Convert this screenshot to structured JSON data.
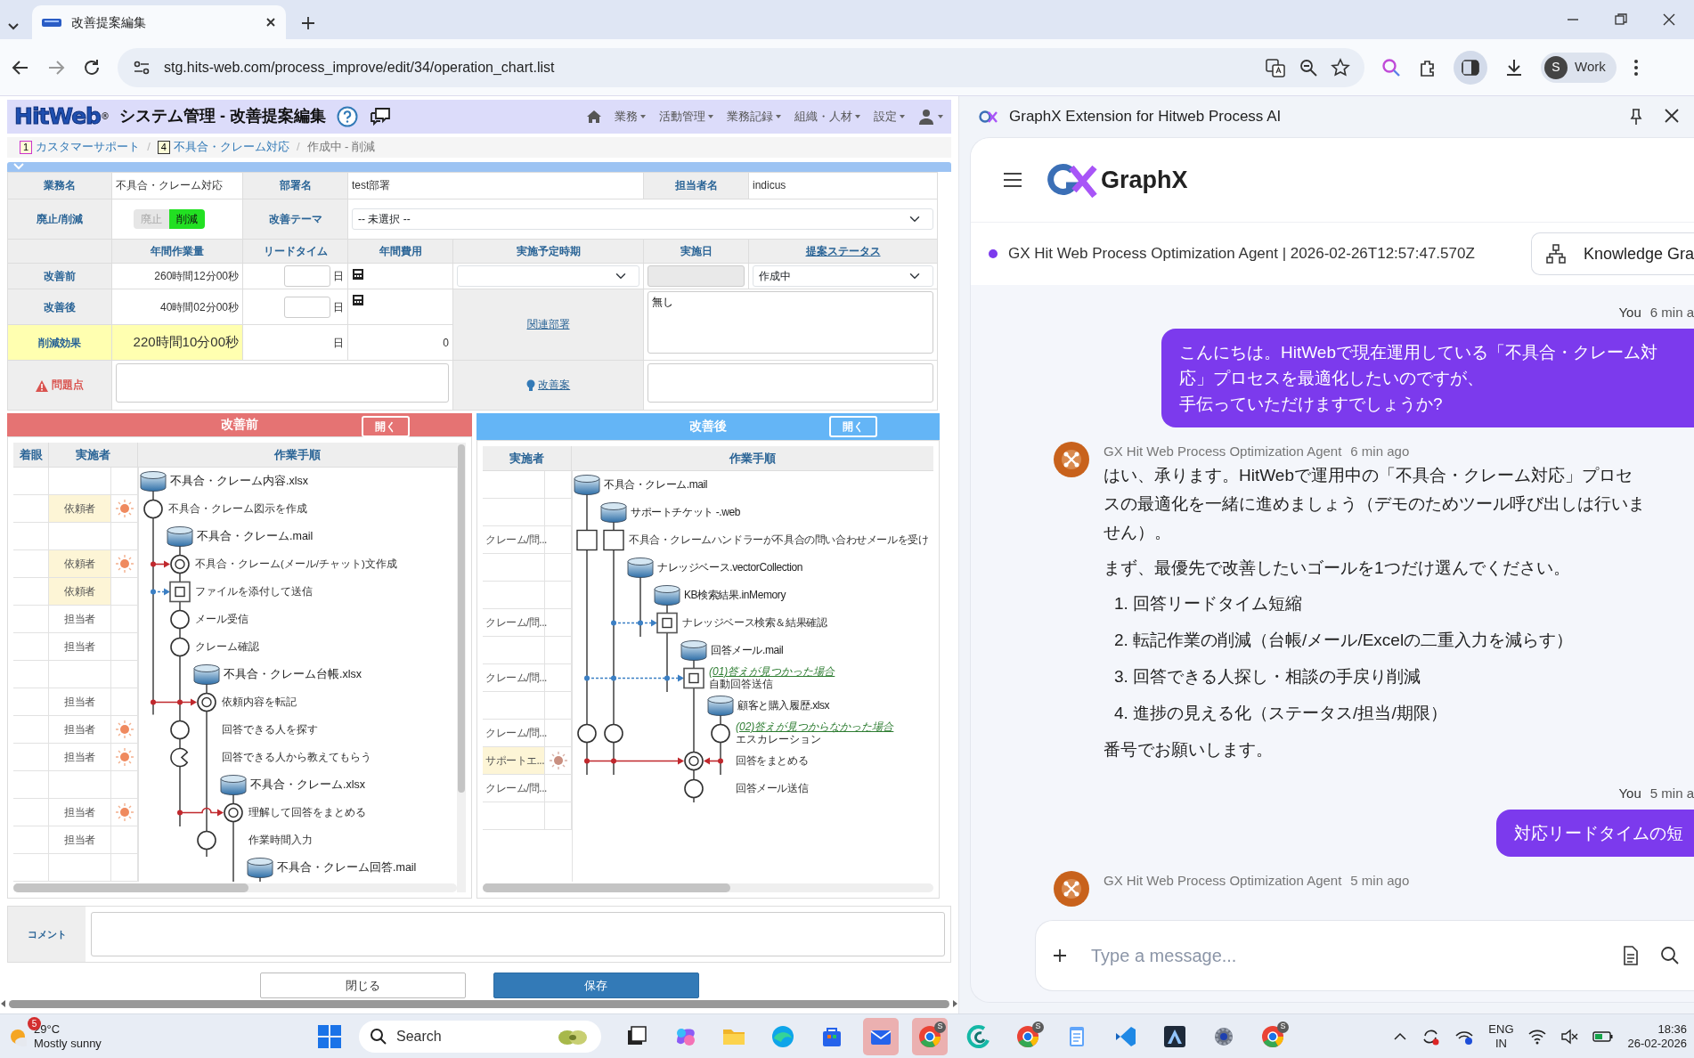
{
  "browser": {
    "tab": {
      "title": "改善提案編集",
      "selected": true
    },
    "url": "stg.hits-web.com/process_improve/edit/34/operation_chart.list",
    "profile": {
      "initial": "S",
      "label": "Work"
    }
  },
  "app": {
    "logo": "HitWeb",
    "logo_mark": "®",
    "title": "システム管理 - 改善提案編集",
    "nav": [
      "業務",
      "活動管理",
      "業務記録",
      "組織・人材",
      "設定"
    ],
    "breadcrumb": [
      {
        "badge": "1",
        "label": "カスタマーサポート",
        "color": "#cc33cc"
      },
      {
        "separator": "/",
        "badge": "4",
        "label": "不具合・クレーム対応",
        "color": "#333333"
      },
      {
        "separator": "/",
        "label": "作成中 - 削減"
      }
    ]
  },
  "form": {
    "task_label": "業務名",
    "task": "不具合・クレーム対応",
    "dept_label": "部署名",
    "dept": "test部署",
    "owner_label": "担当者名",
    "owner": "indicus",
    "toggle_label": "廃止/削減",
    "toggle": [
      {
        "label": "廃止",
        "selected": false
      },
      {
        "label": "削減",
        "selected": true
      }
    ],
    "theme_label": "改善テーマ",
    "theme": "-- 未選択 --",
    "columns": [
      "年間作業量",
      "リードタイム",
      "年間費用",
      "実施予定時期",
      "実施日",
      "提案ステータス"
    ],
    "before": {
      "label": "改善前",
      "workload": "260時間12分00秒",
      "unit": "日"
    },
    "after": {
      "label": "改善後",
      "workload": "40時間02分00秒",
      "unit": "日"
    },
    "effect": {
      "label": "削減効果",
      "workload": "220時間10分00秒",
      "unit": "日",
      "cost": "0"
    },
    "status": "作成中",
    "related_label": "関連部署",
    "related": "無し",
    "problem_label": "問題点",
    "proposal_label": "改善案"
  },
  "before_panel": {
    "title": "改善前",
    "open_button": "開く",
    "columns": [
      "着眼",
      "実施者",
      "作業手順"
    ],
    "steps": [
      {
        "highlighted": false,
        "flagged": false,
        "kind": "data",
        "label": "不具合・クレーム内容.xlsx"
      },
      {
        "actor": "依頼者",
        "highlighted": true,
        "flagged": true,
        "kind": "process",
        "label": "不具合・クレーム図示を作成"
      },
      {
        "highlighted": false,
        "flagged": false,
        "kind": "data",
        "label": "不具合・クレーム.mail"
      },
      {
        "actor": "依頼者",
        "highlighted": true,
        "flagged": true,
        "kind": "process-double",
        "label": "不具合・クレーム(メール/チャット)文作成"
      },
      {
        "actor": "依頼者",
        "highlighted": true,
        "flagged": false,
        "kind": "transfer-double",
        "label": "ファイルを添付して送信"
      },
      {
        "actor": "担当者",
        "highlighted": false,
        "flagged": false,
        "kind": "process",
        "label": "メール受信"
      },
      {
        "actor": "担当者",
        "highlighted": false,
        "flagged": false,
        "kind": "process",
        "label": "クレーム確認"
      },
      {
        "highlighted": false,
        "flagged": false,
        "kind": "data",
        "label": "不具合・クレーム台帳.xlsx"
      },
      {
        "actor": "担当者",
        "highlighted": false,
        "flagged": false,
        "kind": "process-double",
        "label": "依頼内容を転記"
      },
      {
        "actor": "担当者",
        "highlighted": false,
        "flagged": true,
        "kind": "process",
        "label": "回答できる人を探す"
      },
      {
        "actor": "担当者",
        "highlighted": false,
        "flagged": true,
        "kind": "pacman",
        "label": "回答できる人から教えてもらう"
      },
      {
        "highlighted": false,
        "flagged": false,
        "kind": "data",
        "label": "不具合・クレーム.xlsx"
      },
      {
        "actor": "担当者",
        "highlighted": false,
        "flagged": true,
        "kind": "process-double",
        "label": "理解して回答をまとめる"
      },
      {
        "actor": "担当者",
        "highlighted": false,
        "flagged": false,
        "kind": "process",
        "label": "作業時間入力"
      },
      {
        "highlighted": false,
        "flagged": false,
        "kind": "data",
        "label": "不具合・クレーム回答.mail"
      }
    ]
  },
  "after_panel": {
    "title": "改善後",
    "open_button": "開く",
    "columns": [
      "実施者",
      "作業手順"
    ],
    "steps": [
      {
        "highlighted": false,
        "flagged": false,
        "kind": "data",
        "label": "不具合・クレーム.mail"
      },
      {
        "highlighted": false,
        "flagged": false,
        "kind": "data",
        "label": "サポートチケット -.web"
      },
      {
        "actor": "クレーム/問...",
        "highlighted": false,
        "flagged": false,
        "kind": "transfer",
        "label": "不具合・クレームハンドラーが不具合の問い合わせメールを受け"
      },
      {
        "highlighted": false,
        "flagged": false,
        "kind": "data",
        "label": "ナレッジベース.vectorCollection"
      },
      {
        "highlighted": false,
        "flagged": false,
        "kind": "data",
        "label": "KB検索結果.inMemory"
      },
      {
        "actor": "クレーム/問...",
        "highlighted": false,
        "flagged": false,
        "kind": "transfer-double",
        "label": "ナレッジベース検索＆結果確認"
      },
      {
        "highlighted": false,
        "flagged": false,
        "kind": "data",
        "label": "回答メール.mail"
      },
      {
        "actor": "クレーム/問...",
        "highlighted": false,
        "flagged": false,
        "kind": "transfer-double",
        "link": "(01)答えが見つかった場合",
        "label": "自動回答送信"
      },
      {
        "highlighted": false,
        "flagged": false,
        "kind": "data",
        "label": "顧客と購入履歴.xlsx"
      },
      {
        "actor": "クレーム/問...",
        "highlighted": false,
        "flagged": false,
        "kind": "process",
        "link": "(02)答えが見つからなかった場合",
        "label": "エスカレーション"
      },
      {
        "actor": "サポートエ...",
        "highlighted": true,
        "flagged": true,
        "kind": "process-double",
        "label": "回答をまとめる"
      },
      {
        "actor": "クレーム/問...",
        "highlighted": false,
        "flagged": false,
        "kind": "process",
        "label": "回答メール送信"
      }
    ]
  },
  "comment_label": "コメント",
  "buttons": {
    "close": "閉じる",
    "save": "保存"
  },
  "side_panel": {
    "title": "GraphX Extension for Hitweb Process AI",
    "brand": "GraphX",
    "agent": "GX Hit Web Process Optimization Agent | 2026-02-26T12:57:47.570Z",
    "graph_button": "Knowledge Gra",
    "messages": [
      {
        "kind": "user",
        "author": "You",
        "time": "6 min a",
        "lines": [
          "こんにちは。HitWebで現在運用している「不具合・クレーム対応」プロセスを最適化したいのですが、",
          "手伝っていただけますでしょうか?"
        ]
      },
      {
        "kind": "agent",
        "author": "GX Hit Web Process Optimization Agent",
        "time": "6 min ago",
        "paragraphs": [
          "はい、承ります。HitWebで運用中の「不具合・クレーム対応」プロセスの最適化を一緒に進めましょう（デモのためツール呼び出しは行いません）。",
          "まず、最優先で改善したいゴールを1つだけ選んでください。"
        ],
        "items": [
          "1. 回答リードタイム短縮",
          "2. 転記作業の削減（台帳/メール/Excelの二重入力を減らす）",
          "3. 回答できる人探し・相談の手戻り削減",
          "4. 進捗の見える化（ステータス/担当/期限）"
        ],
        "closing": "番号でお願いします。"
      },
      {
        "kind": "user",
        "author": "You",
        "time": "5 min a",
        "lines": [
          "対応リードタイムの短"
        ]
      },
      {
        "kind": "agent",
        "author": "GX Hit Web Process Optimization Agent",
        "time": "5 min ago"
      }
    ],
    "input_placeholder": "Type a message..."
  },
  "taskbar": {
    "weather": {
      "badge": "5",
      "temp": "29°C",
      "text": "Mostly sunny"
    },
    "search": "Search",
    "apps": [
      {
        "kind": "window",
        "active": false
      },
      {
        "kind": "colorful",
        "active": false
      },
      {
        "kind": "folder",
        "active": false
      },
      {
        "kind": "edge",
        "active": false
      },
      {
        "kind": "bag",
        "active": false
      },
      {
        "kind": "mail",
        "active": true
      },
      {
        "kind": "browser",
        "badge": "S",
        "active": true
      },
      {
        "kind": "swirl",
        "active": false
      },
      {
        "kind": "browser",
        "badge": "S",
        "active": false
      },
      {
        "kind": "notepad",
        "active": false
      },
      {
        "kind": "code",
        "active": false
      },
      {
        "kind": "triangle",
        "active": false
      },
      {
        "kind": "gear",
        "active": false
      },
      {
        "kind": "browser",
        "badge": "S",
        "active": false
      }
    ],
    "lang": "ENG",
    "region": "IN",
    "time": "18:36",
    "date": "26-02-2026"
  }
}
